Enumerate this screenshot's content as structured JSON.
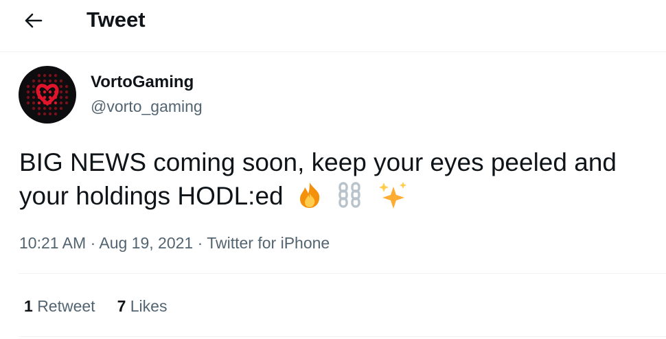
{
  "header": {
    "title": "Tweet",
    "back_icon": "arrow-left-icon"
  },
  "author": {
    "display_name": "VortoGaming",
    "handle": "@vorto_gaming",
    "avatar_icon": "vorto-logo"
  },
  "tweet": {
    "text": "BIG NEWS coming soon, keep your eyes peeled and your holdings HODL:ed",
    "emojis": [
      "fire-emoji",
      "chain-emoji",
      "sparkles-emoji"
    ],
    "time": "10:21 AM",
    "date": "Aug 19, 2021",
    "source": "Twitter for iPhone",
    "separator": " · "
  },
  "stats": {
    "retweets_count": "1",
    "retweets_label": "Retweet",
    "likes_count": "7",
    "likes_label": "Likes"
  },
  "colors": {
    "text": "#0f1419",
    "secondary": "#536471",
    "divider": "#eff3f4",
    "avatar_bg": "#0d0d10",
    "avatar_accent": "#e0142b"
  }
}
